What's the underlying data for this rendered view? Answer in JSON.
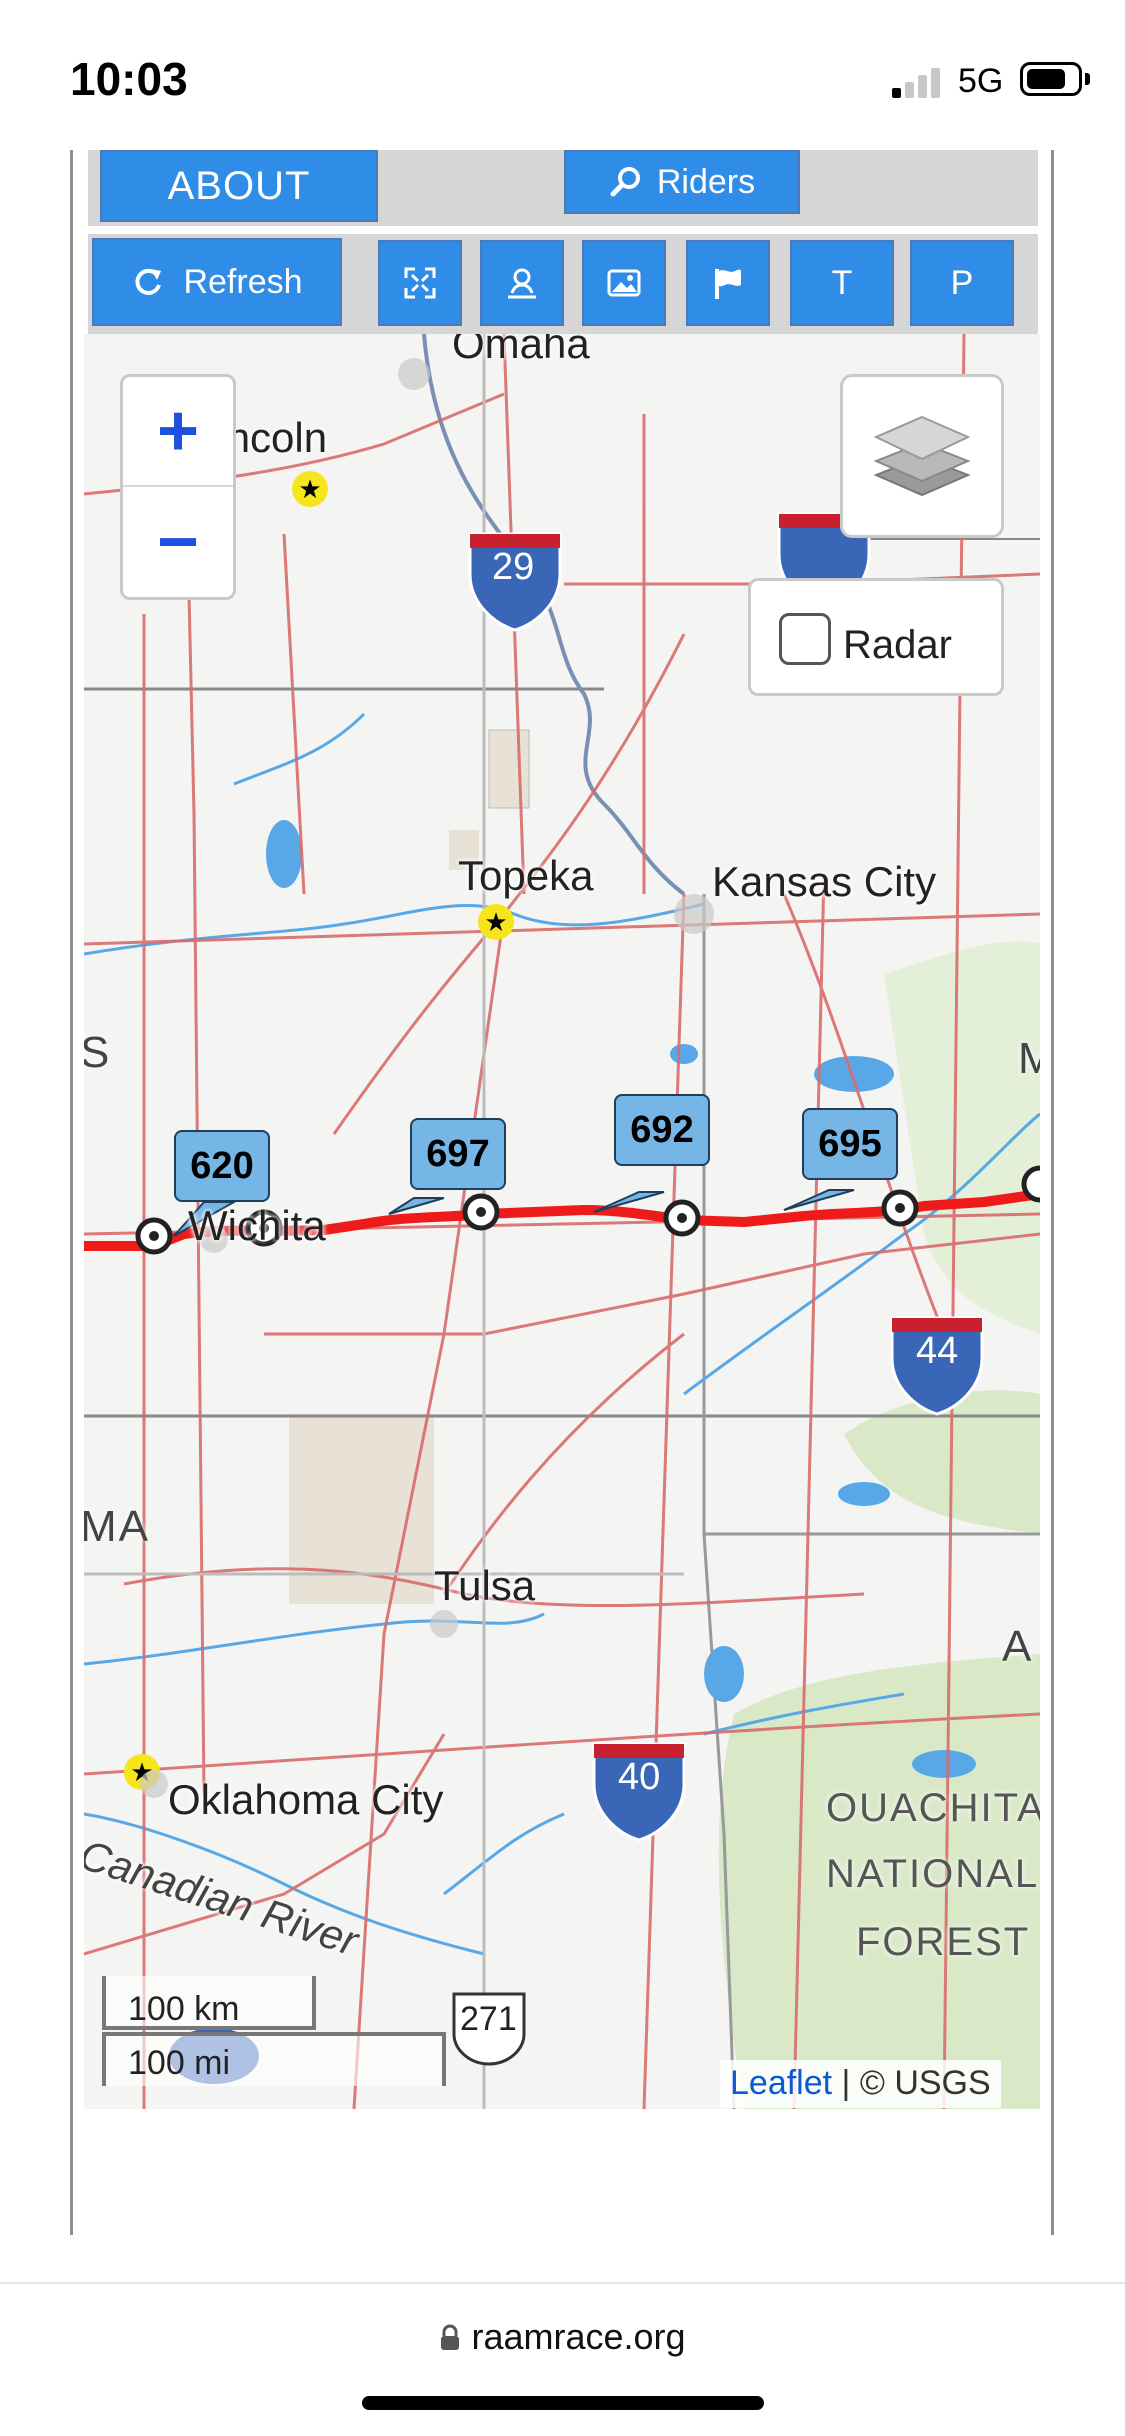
{
  "status": {
    "time": "10:03",
    "network": "5G"
  },
  "toolbar": {
    "about_label": "ABOUT",
    "riders_label": "Riders",
    "refresh_label": "Refresh",
    "t_label": "T",
    "p_label": "P"
  },
  "map": {
    "zoom_in": "+",
    "zoom_out": "−",
    "radar_label": "Radar",
    "cities": {
      "omaha": "Omaha",
      "lincoln": "Lincoln",
      "topeka": "Topeka",
      "kansas_city": "Kansas City",
      "wichita": "Wichita",
      "tulsa": "Tulsa",
      "oklahoma_city": "Oklahoma City",
      "canadian_river": "Canadian River"
    },
    "region_labels": {
      "s": "S",
      "ma": "MA",
      "m": "M",
      "a": "A",
      "forest1": "OUACHITA",
      "forest2": "NATIONAL",
      "forest3": "FOREST"
    },
    "interstates": {
      "i29": "29",
      "i44": "44",
      "i40": "40",
      "us271": "271"
    },
    "rider_markers": [
      {
        "label": "620"
      },
      {
        "label": "697"
      },
      {
        "label": "692"
      },
      {
        "label": "695"
      }
    ],
    "scale_km": "100 km",
    "scale_mi": "100 mi",
    "attribution_link": "Leaflet",
    "attribution_rest": " | © USGS"
  },
  "browser": {
    "url": "raamrace.org"
  }
}
